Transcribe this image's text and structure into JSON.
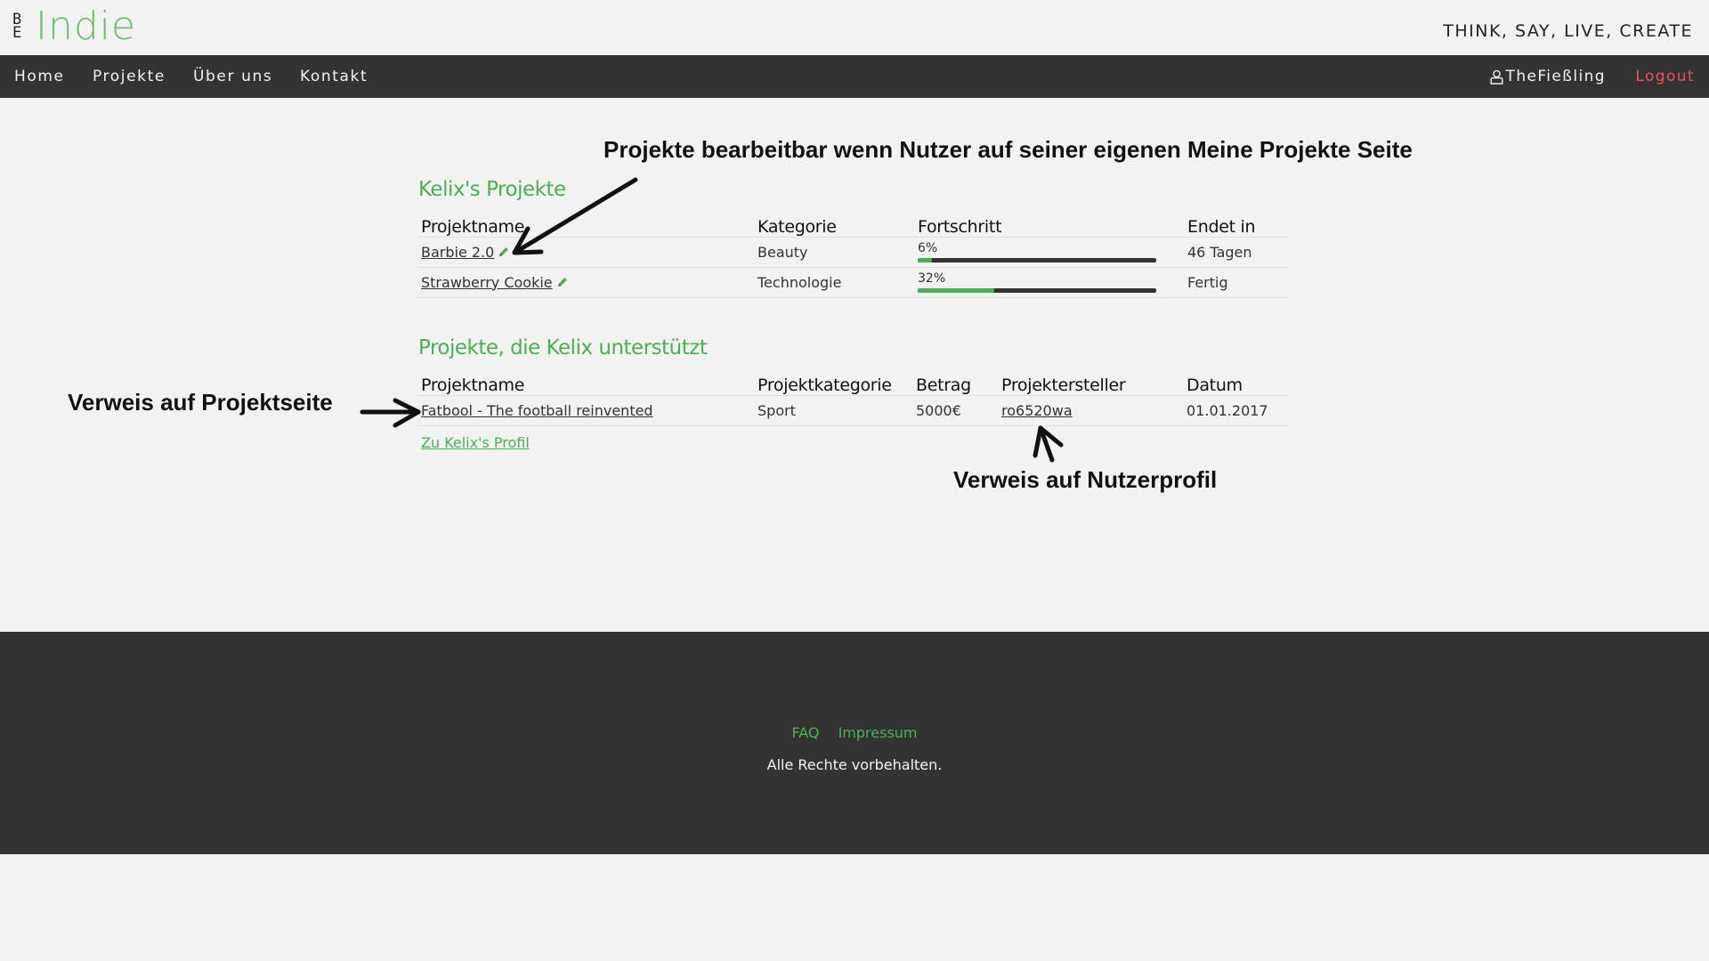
{
  "header": {
    "logo_mark_top": "B",
    "logo_mark_bottom": "E",
    "logo_text": "Indie",
    "tagline": "THINK, SAY, LIVE, CREATE"
  },
  "nav": {
    "items": [
      {
        "label": "Home"
      },
      {
        "label": "Projekte"
      },
      {
        "label": "Über uns"
      },
      {
        "label": "Kontakt"
      }
    ],
    "user_label": "TheFießling",
    "user_icon": "user-icon",
    "logout_label": "Logout"
  },
  "own_projects": {
    "title": "Kelix's Projekte",
    "columns": [
      "Projektname",
      "Kategorie",
      "Fortschritt",
      "Endet in"
    ],
    "rows": [
      {
        "name": "Barbie 2.0",
        "category": "Beauty",
        "progress_label": "6%",
        "progress": 0.06,
        "ends": "46 Tagen"
      },
      {
        "name": "Strawberry Cookie",
        "category": "Technologie",
        "progress_label": "32%",
        "progress": 0.32,
        "ends": "Fertig"
      }
    ],
    "edit_icon": "pencil-icon"
  },
  "supported_projects": {
    "title": "Projekte, die Kelix unterstützt",
    "columns": [
      "Projektname",
      "Projektkategorie",
      "Betrag",
      "Projektersteller",
      "Datum"
    ],
    "rows": [
      {
        "name": "Fatbool - The football reinvented",
        "category": "Sport",
        "amount": "5000€",
        "creator": "ro6520wa",
        "date": "01.01.2017"
      }
    ],
    "profile_link": "Zu Kelix's Profil"
  },
  "annotations": {
    "edit_note": "Projekte bearbeitbar wenn Nutzer auf seiner eigenen Meine Projekte Seite",
    "project_link_note": "Verweis auf Projektseite",
    "profile_link_note": "Verweis auf Nutzerprofil"
  },
  "footer": {
    "links": [
      {
        "label": "FAQ"
      },
      {
        "label": "Impressum"
      }
    ],
    "copyright": "Alle Rechte vorbehalten."
  },
  "colors": {
    "accent": "#4caf50",
    "nav_bg": "#333333",
    "logout": "#e8554e",
    "page_bg": "#f2f2f2"
  }
}
